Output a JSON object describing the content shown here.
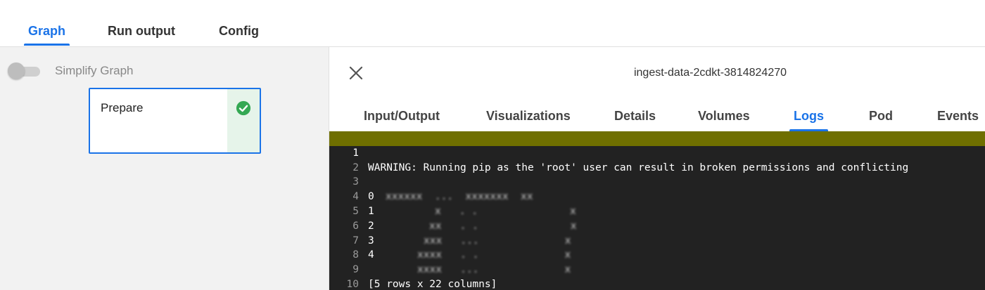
{
  "top_tabs": [
    {
      "label": "Graph",
      "active": true
    },
    {
      "label": "Run output",
      "active": false
    },
    {
      "label": "Config",
      "active": false
    }
  ],
  "graph": {
    "simplify_label": "Simplify Graph",
    "simplify_on": false,
    "node": {
      "label": "Prepare",
      "status": "succeeded",
      "status_icon": "check-circle-icon",
      "status_color": "#34a853"
    }
  },
  "detail": {
    "title": "ingest-data-2cdkt-3814824270",
    "tabs": [
      {
        "label": "Input/Output"
      },
      {
        "label": "Visualizations"
      },
      {
        "label": "Details"
      },
      {
        "label": "Volumes"
      },
      {
        "label": "Logs",
        "active": true
      },
      {
        "label": "Pod"
      },
      {
        "label": "Events"
      }
    ],
    "logs": [
      {
        "n": "1",
        "text": "WARNING: Running pip as the 'root' user can result in broken permissions and conflicting"
      },
      {
        "n": "2",
        "text": ""
      },
      {
        "n": "3",
        "text": "0"
      },
      {
        "n": "4",
        "text": "1"
      },
      {
        "n": "5",
        "text": "2"
      },
      {
        "n": "6",
        "text": "3"
      },
      {
        "n": "7",
        "text": "4"
      },
      {
        "n": "8",
        "text": ""
      },
      {
        "n": "9",
        "text": "[5 rows x 22 columns]"
      },
      {
        "n": "10",
        "text": ""
      }
    ]
  },
  "colors": {
    "accent": "#1a73e8",
    "warning_bg": "#6f6f00",
    "log_bg": "#222222",
    "success": "#34a853"
  }
}
